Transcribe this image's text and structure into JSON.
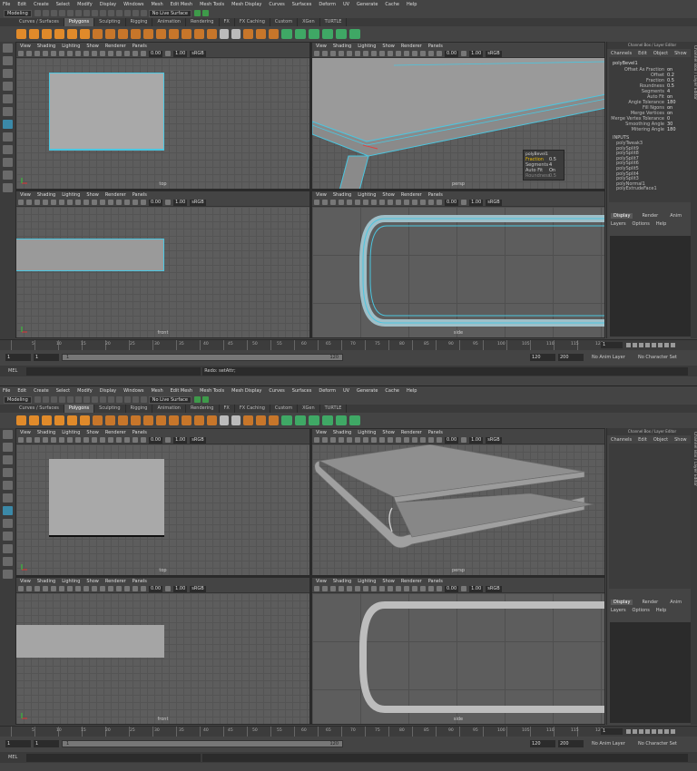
{
  "menu": [
    "File",
    "Edit",
    "Create",
    "Select",
    "Modify",
    "Display",
    "Windows",
    "Mesh",
    "Edit Mesh",
    "Mesh Tools",
    "Mesh Display",
    "Curves",
    "Surfaces",
    "Deform",
    "UV",
    "Generate",
    "Cache",
    "Help"
  ],
  "status": {
    "workspace": "Modeling",
    "live_surface": "No Live Surface"
  },
  "shelf_tabs": [
    "Curves / Surfaces",
    "Polygons",
    "Sculpting",
    "Rigging",
    "Animation",
    "Rendering",
    "FX",
    "FX Caching",
    "Custom",
    "XGen",
    "TURTLE"
  ],
  "shelf_active": "Polygons",
  "viewport_menu": [
    "View",
    "Shading",
    "Lighting",
    "Show",
    "Renderer",
    "Panels"
  ],
  "viewport_values": {
    "exposure": "0.00",
    "gamma": "1.00",
    "colorspace": "sRGB"
  },
  "viewports": {
    "top": "top",
    "persp": "persp",
    "front": "front",
    "side": "side"
  },
  "channel_box": {
    "header": "Channel Box / Layer Editor",
    "menu": [
      "Channels",
      "Edit",
      "Object",
      "Show"
    ],
    "node": "polyBevel1",
    "attrs": [
      {
        "k": "Offset As Fraction",
        "v": "on"
      },
      {
        "k": "Offset",
        "v": "0.2"
      },
      {
        "k": "Fraction",
        "v": "0.5"
      },
      {
        "k": "Roundness",
        "v": "0.5"
      },
      {
        "k": "Segments",
        "v": "4"
      },
      {
        "k": "Auto Fit",
        "v": "on"
      },
      {
        "k": "Angle Tolerance",
        "v": "180"
      },
      {
        "k": "Fill Ngons",
        "v": "on"
      },
      {
        "k": "Merge Vertices",
        "v": "on"
      },
      {
        "k": "Merge Vertex Tolerance",
        "v": "0"
      },
      {
        "k": "Smoothing Angle",
        "v": "30"
      },
      {
        "k": "Mitering Angle",
        "v": "180"
      }
    ],
    "inputs_label": "INPUTS",
    "inputs": [
      "polyTweak3",
      "polySplit9",
      "polySplit8",
      "polySplit7",
      "polySplit6",
      "polySplit5",
      "polySplit4",
      "polySplit3",
      "polyNormal1",
      "polyExtrudeFace1"
    ]
  },
  "layer_editor": {
    "tabs": [
      "Display",
      "Render",
      "Anim"
    ],
    "menu": [
      "Layers",
      "Options",
      "Help"
    ]
  },
  "side_tabs": [
    "Channel Box / Layer Editor",
    "Attribute Editor"
  ],
  "bevel_popup": {
    "title": "polyBevel1",
    "rows": [
      {
        "k": "Fraction",
        "v": "0.5"
      },
      {
        "k": "Segments",
        "v": "4"
      },
      {
        "k": "Auto Fit",
        "v": "On"
      },
      {
        "k": "Roundness",
        "v": "0.5"
      }
    ]
  },
  "timeline": {
    "ticks": [
      "5",
      "10",
      "15",
      "20",
      "25",
      "30",
      "35",
      "40",
      "45",
      "50",
      "55",
      "60",
      "65",
      "70",
      "75",
      "80",
      "85",
      "90",
      "95",
      "100",
      "105",
      "110",
      "115",
      "120"
    ],
    "current_frame": "1"
  },
  "range": {
    "start": "1",
    "start2": "1",
    "slider_start": "1",
    "slider_end": "120",
    "end": "120",
    "end2": "200",
    "anim_layer": "No Anim Layer",
    "char_set": "No Character Set"
  },
  "cmdline": {
    "label": "MEL",
    "result_top": "Redo: setAttr;",
    "result_bottom": ""
  }
}
